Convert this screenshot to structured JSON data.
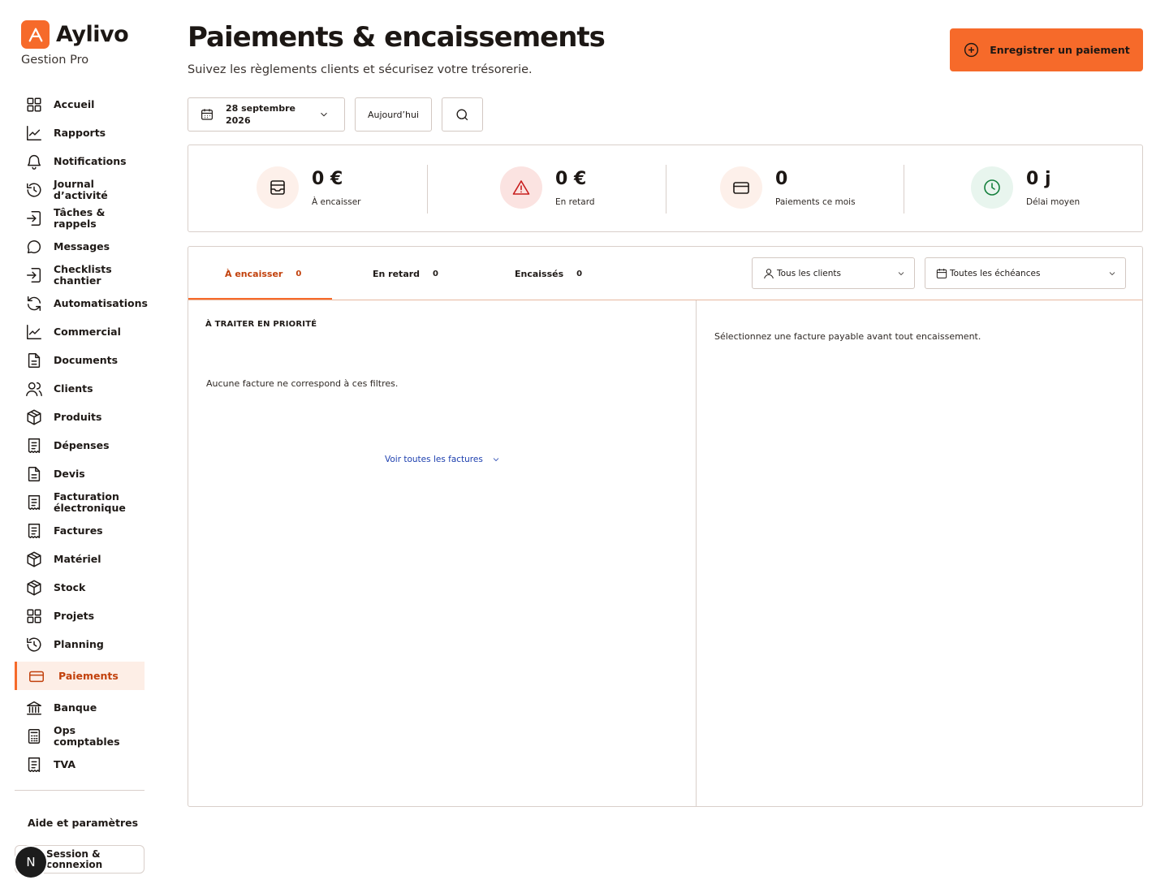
{
  "brand": {
    "name": "Aylivo",
    "subtitle": "Gestion Pro",
    "color": "#f66a2a"
  },
  "sidebar": {
    "items": [
      {
        "label": "Accueil",
        "icon": "grid-icon"
      },
      {
        "label": "Rapports",
        "icon": "chart-line-icon"
      },
      {
        "label": "Notifications",
        "icon": "bell-icon"
      },
      {
        "label": "Journal d’activité",
        "icon": "history-icon"
      },
      {
        "label": "Tâches & rappels",
        "icon": "login-arrow-icon"
      },
      {
        "label": "Messages",
        "icon": "chat-bubble-icon"
      },
      {
        "label": "Checklists chantier",
        "icon": "login-arrow-icon"
      },
      {
        "label": "Automatisations",
        "icon": "refresh-icon"
      },
      {
        "label": "Commercial",
        "icon": "chart-line-icon"
      },
      {
        "label": "Documents",
        "icon": "document-icon"
      },
      {
        "label": "Clients",
        "icon": "users-icon"
      },
      {
        "label": "Produits",
        "icon": "box-icon"
      },
      {
        "label": "Dépenses",
        "icon": "receipt-icon"
      },
      {
        "label": "Devis",
        "icon": "document-icon"
      },
      {
        "label": "Facturation électronique",
        "icon": "receipt-icon"
      },
      {
        "label": "Factures",
        "icon": "receipt-icon"
      },
      {
        "label": "Matériel",
        "icon": "box-icon"
      },
      {
        "label": "Stock",
        "icon": "box-icon"
      },
      {
        "label": "Projets",
        "icon": "grid-icon"
      },
      {
        "label": "Planning",
        "icon": "history-icon"
      },
      {
        "label": "Paiements",
        "icon": "credit-card-icon",
        "active": true
      },
      {
        "label": "Banque",
        "icon": "bank-icon"
      },
      {
        "label": "Ops comptables",
        "icon": "calculator-icon"
      },
      {
        "label": "TVA",
        "icon": "receipt-icon"
      }
    ],
    "help_label": "Aide et paramètres",
    "session_label": "Session & connexion",
    "avatar_letter": "N"
  },
  "header": {
    "title": "Paiements & encaissements",
    "subtitle": "Suivez les règlements clients et sécurisez votre trésorerie.",
    "cta_label": "Enregistrer un paiement"
  },
  "toolbar": {
    "date_label": "28 septembre 2026",
    "today_label": "Aujourd’hui"
  },
  "kpis": [
    {
      "value": "0 €",
      "label": "À encaisser",
      "icon": "inbox-icon",
      "bg": "#fdf0ea",
      "fg": "#1f1a17"
    },
    {
      "value": "0 €",
      "label": "En retard",
      "icon": "warning-icon",
      "bg": "#fbe3e1",
      "fg": "#c81e1e"
    },
    {
      "value": "0",
      "label": "Paiements ce mois",
      "icon": "credit-card-icon",
      "bg": "#fdf0ea",
      "fg": "#1f1a17"
    },
    {
      "value": "0 j",
      "label": "Délai moyen",
      "icon": "clock-icon",
      "bg": "#e8f5ee",
      "fg": "#15803d"
    }
  ],
  "tabs": [
    {
      "label": "À encaisser",
      "count": "0",
      "active": true
    },
    {
      "label": "En retard",
      "count": "0"
    },
    {
      "label": "Encaissés",
      "count": "0"
    }
  ],
  "filters": {
    "clients": "Tous les clients",
    "due": "Toutes les échéances"
  },
  "left": {
    "section_title": "À TRAITER EN PRIORITÉ",
    "empty": "Aucune facture ne correspond à ces filtres.",
    "see_all": "Voir toutes les factures"
  },
  "right": {
    "message": "Sélectionnez une facture payable avant tout encaissement."
  }
}
